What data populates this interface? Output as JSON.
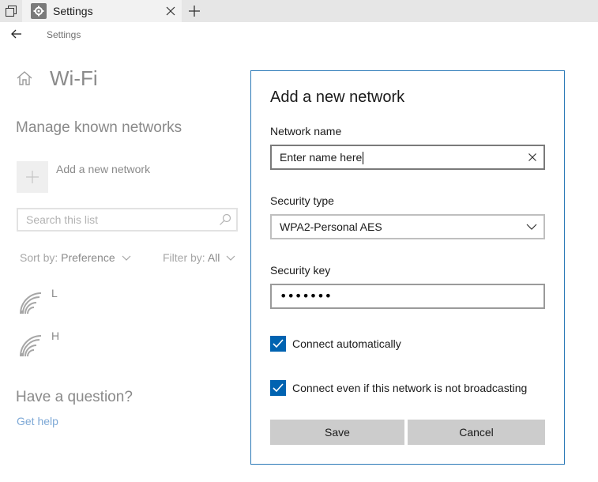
{
  "window": {
    "tab_title": "Settings"
  },
  "header": {
    "breadcrumb": "Settings"
  },
  "page": {
    "title": "Wi-Fi",
    "section_title": "Manage known networks",
    "add_network_label": "Add a new network",
    "search_placeholder": "Search this list",
    "sort_label": "Sort by:",
    "sort_value": "Preference",
    "filter_label": "Filter by:",
    "filter_value": "All",
    "networks": [
      {
        "name": "L"
      },
      {
        "name": "H"
      }
    ],
    "question_heading": "Have a question?",
    "help_link": "Get help"
  },
  "dialog": {
    "title": "Add a new network",
    "network_name_label": "Network name",
    "network_name_value": "Enter name here",
    "security_type_label": "Security type",
    "security_type_value": "WPA2-Personal AES",
    "security_key_label": "Security key",
    "security_key_value": "•••••••",
    "connect_automatically": {
      "label": "Connect automatically",
      "checked": true
    },
    "connect_hidden": {
      "label": "Connect even if this network is not broadcasting",
      "checked": true
    },
    "save_label": "Save",
    "cancel_label": "Cancel"
  },
  "colors": {
    "accent": "#0063b1",
    "dialog_border": "#2b79b7",
    "link": "#7da8d6"
  }
}
